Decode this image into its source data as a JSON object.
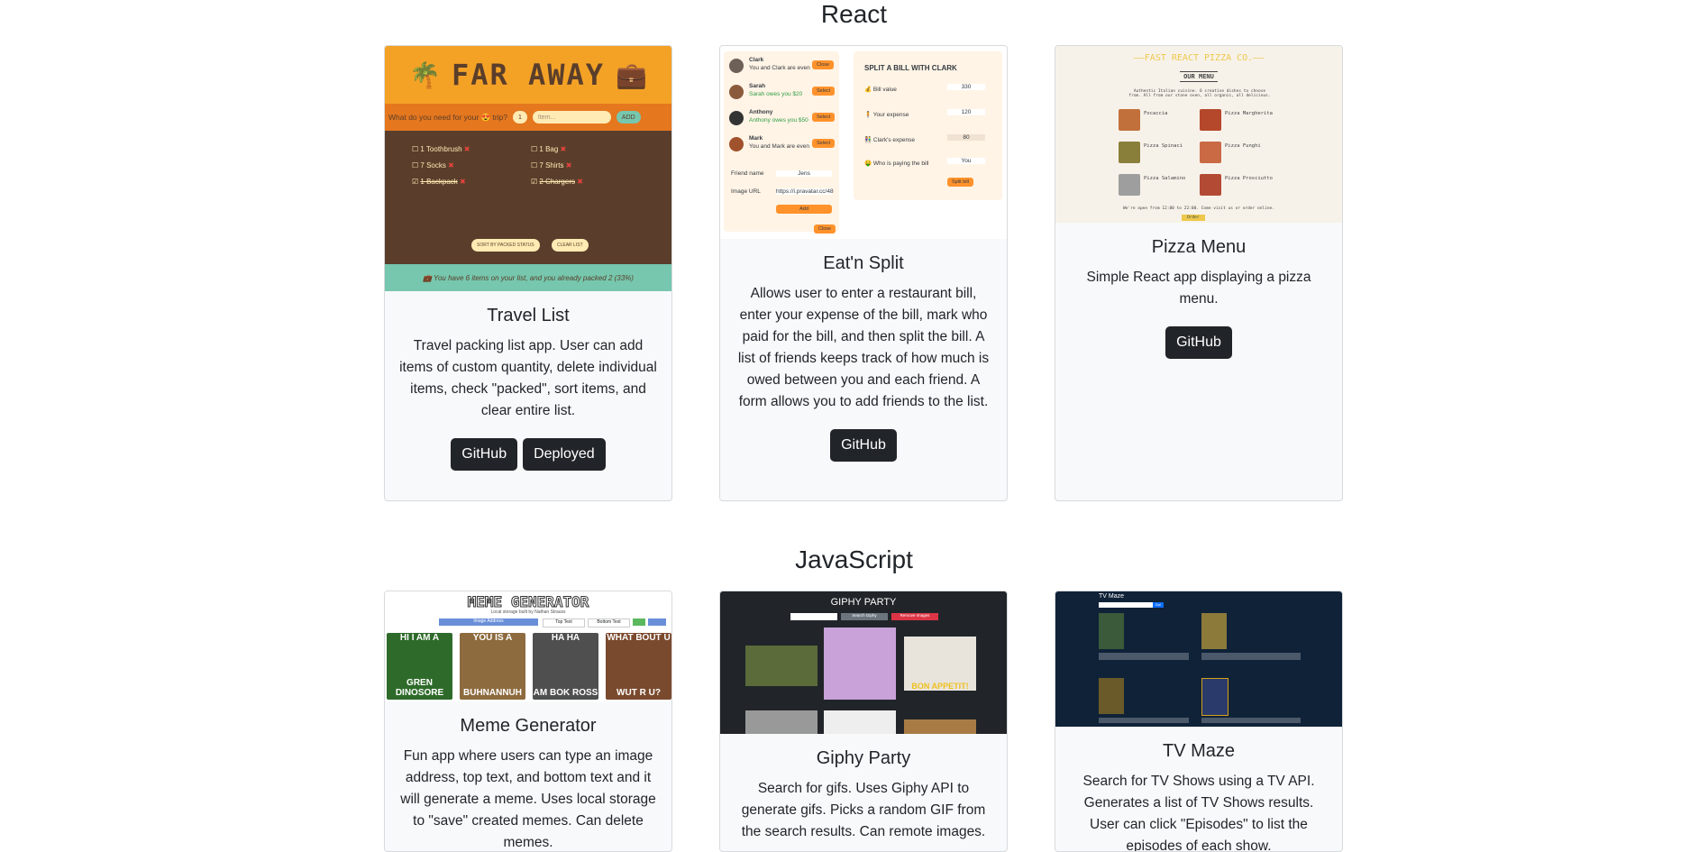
{
  "sections": {
    "react": "React",
    "javascript": "JavaScript"
  },
  "projects": {
    "travel": {
      "title": "Travel List",
      "desc": "Travel packing list app. User can add items of custom quantity, delete individual items, check \"packed\", sort items, and clear entire list.",
      "github": "GitHub",
      "deployed": "Deployed",
      "preview": {
        "logo": "FAR AWAY",
        "prompt": "What do you need for your 😍 trip?",
        "qty": "1",
        "placeholder": "Item...",
        "add": "ADD",
        "items": [
          "1 Toothbrush",
          "1 Bag",
          "7 Socks",
          "7 Shirts",
          "1 Backpack",
          "2 Chargers"
        ],
        "sort": "SORT BY PACKED STATUS",
        "clear": "CLEAR LIST",
        "footer": "💼 You have 6 items on your list, and you already packed 2 (33%)"
      }
    },
    "split": {
      "title": "Eat'n Split",
      "desc": "Allows user to enter a restaurant bill, enter your expense of the bill, mark who paid for the bill, and then split the bill. A list of friends keeps track of how much is owed between you and each friend. A form allows you to add friends to the list.",
      "github": "GitHub",
      "preview": {
        "friends": [
          {
            "name": "Clark",
            "status": "You and Clark are even",
            "btn": "Close"
          },
          {
            "name": "Sarah",
            "status": "Sarah owes you $20",
            "btn": "Select"
          },
          {
            "name": "Anthony",
            "status": "Anthony owes you $50",
            "btn": "Select"
          },
          {
            "name": "Mark",
            "status": "You and Mark are even",
            "btn": "Select"
          }
        ],
        "friend_label": "Friend name",
        "friend_value": "Jens",
        "image_label": "Image URL",
        "image_value": "https://i.pravatar.cc/48",
        "add": "Add",
        "close": "Close",
        "split_title": "SPLIT A BILL WITH CLARK",
        "bill_label": "Bill value",
        "bill_value": "330",
        "expense_label": "Your expense",
        "expense_value": "120",
        "clark_label": "Clark's expense",
        "clark_value": "80",
        "payer_label": "Who is paying the bill",
        "payer_value": "You",
        "split_btn": "Split bill"
      }
    },
    "pizza": {
      "title": "Pizza Menu",
      "desc": "Simple React app displaying a pizza menu.",
      "github": "GitHub",
      "preview": {
        "header": "FAST REACT PIZZA CO.",
        "menu": "OUR MENU",
        "intro": "Authentic Italian cuisine. 6 creative dishes to choose from. All from our stone oven, all organic, all delicious.",
        "pizzas": [
          "Focaccia",
          "Pizza Margherita",
          "Pizza Spinaci",
          "Pizza Funghi",
          "Pizza Salamino",
          "Pizza Prosciutto"
        ],
        "open": "We're open from 12:00 to 22:00. Come visit us or order online.",
        "order": "Order"
      }
    },
    "meme": {
      "title": "Meme Generator",
      "desc": "Fun app where users can type an image address, top text, and bottom text and it will generate a meme. Uses local storage to \"save\" created memes. Can delete memes.",
      "preview": {
        "header": "MEME GENERATOR",
        "sub": "Local storage built by Nathan Strauss",
        "fields": [
          "Image Address",
          "Top Text",
          "Bottom Text"
        ],
        "memes": [
          {
            "top": "HI I AM A",
            "bottom": "GREN DINOSORE"
          },
          {
            "top": "YOU IS A",
            "bottom": "BUHNANNUH"
          },
          {
            "top": "HA HA",
            "bottom": "AM BOK ROSS"
          },
          {
            "top": "WHAT BOUT U",
            "bottom": "WUT R U?"
          }
        ]
      }
    },
    "giphy": {
      "title": "Giphy Party",
      "desc": "Search for gifs. Uses Giphy API to generate gifs. Picks a random GIF from the search results. Can remote images.",
      "preview": {
        "header": "GIPHY PARTY",
        "search": "Search Giphy",
        "remove": "Remove Images",
        "caption": "BON APPETIT!"
      }
    },
    "tvmaze": {
      "title": "TV Maze",
      "desc": "Search for TV Shows using a TV API. Generates a list of TV Shows results. User can click \"Episodes\" to list the episodes of each show.",
      "preview": {
        "header": "TV Maze",
        "search": "Go!"
      }
    }
  }
}
